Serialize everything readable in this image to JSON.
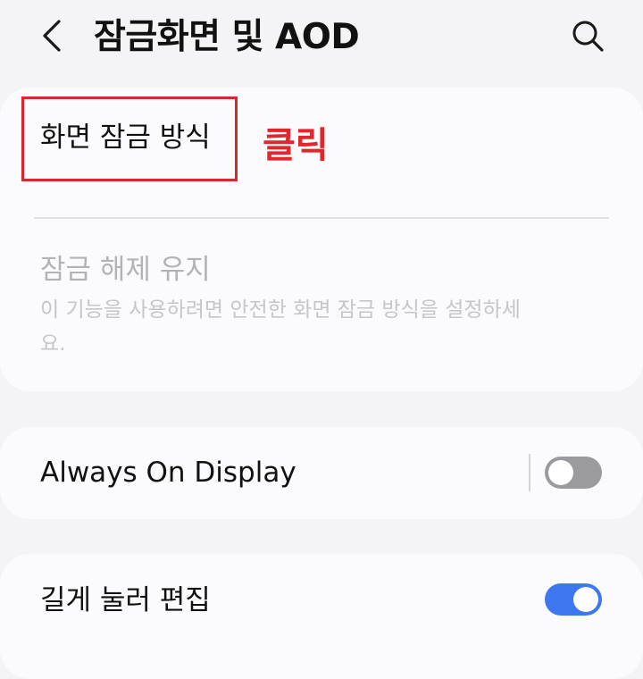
{
  "header": {
    "back_icon": "chevron-left-icon",
    "title": "잠금화면 및 AOD",
    "search_icon": "search-icon"
  },
  "lock_card": {
    "screen_lock_type": {
      "label": "화면 잠금 방식"
    },
    "annotation": {
      "text": "클릭",
      "color": "#e2262c"
    },
    "keep_unlocked": {
      "title": "잠금 해제 유지",
      "description": "이 기능을 사용하려면 안전한 화면 잠금 방식을 설정하세요.",
      "enabled": false
    }
  },
  "aod_card": {
    "label": "Always On Display",
    "toggle_on": false
  },
  "edit_card": {
    "label": "길게 눌러 편집",
    "toggle_on": true
  },
  "colors": {
    "background": "#f4f4f6",
    "card": "#fbfbfd",
    "toggle_on": "#3e78f0",
    "toggle_off": "#9b9b9f",
    "highlight": "#d7262c"
  }
}
